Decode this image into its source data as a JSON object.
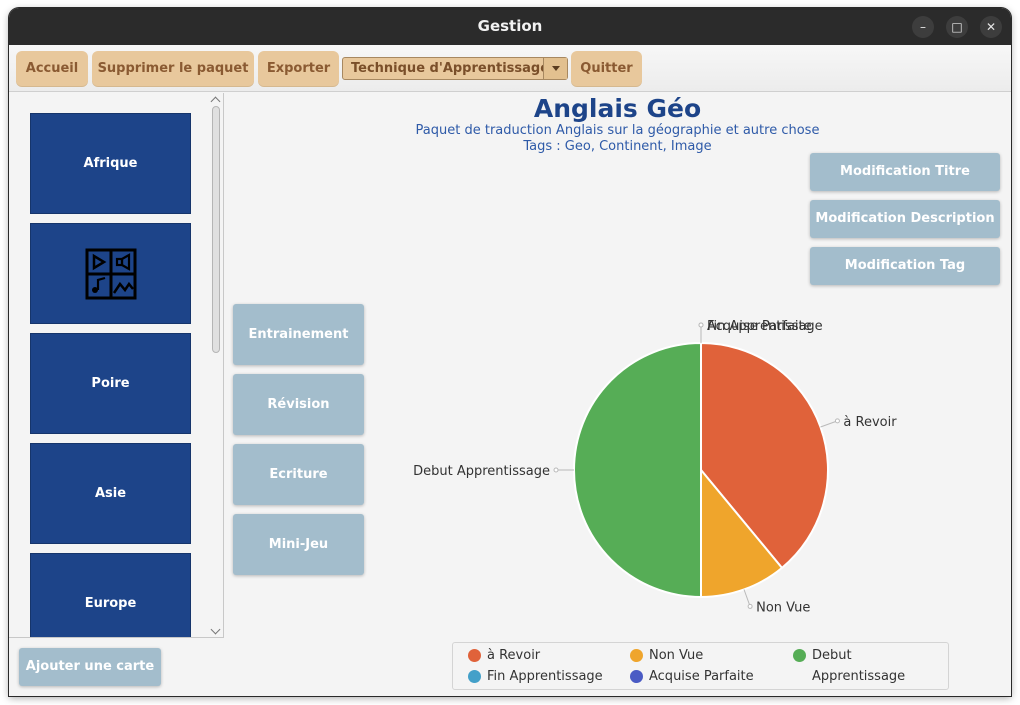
{
  "window": {
    "title": "Gestion",
    "controls": [
      "minimize",
      "maximize",
      "close"
    ]
  },
  "toolbar": {
    "accueil": "Accueil",
    "supprimer": "Supprimer le paquet",
    "exporter": "Exporter",
    "technique": {
      "selected": "Technique d'Apprentissage"
    },
    "quitter": "Quitter"
  },
  "cards": [
    {
      "label": "Afrique",
      "icon": null
    },
    {
      "label": "",
      "icon": "media-grid-icon"
    },
    {
      "label": "Poire",
      "icon": null
    },
    {
      "label": "Asie",
      "icon": null
    },
    {
      "label": "Europe",
      "icon": null
    }
  ],
  "add_card": "Ajouter une carte",
  "deck": {
    "title": "Anglais Géo",
    "description": "Paquet de traduction Anglais sur la géographie et autre chose",
    "tags": "Tags : Geo, Continent, Image"
  },
  "modify_buttons": {
    "title": "Modification Titre",
    "description": "Modification Description",
    "tag": "Modification Tag"
  },
  "study_buttons": {
    "entrainement": "Entrainement",
    "revision": "Révision",
    "ecriture": "Ecriture",
    "minijeu": "Mini-Jeu"
  },
  "colors": {
    "card": "#1d4489",
    "toolbar_button": "#e8c89c",
    "action_button": "#a3bdcc",
    "title": "#1d4489"
  },
  "chart_data": {
    "type": "pie",
    "slices": [
      {
        "label": "à Revoir",
        "value": 39,
        "color": "#e0623a"
      },
      {
        "label": "Non Vue",
        "value": 11,
        "color": "#efa52c"
      },
      {
        "label": "Debut Apprentissage",
        "value": 50,
        "color": "#56ad56"
      },
      {
        "label": "Fin Apprentissage",
        "value": 0,
        "color": "#43a0c9"
      },
      {
        "label": "Acquise Parfaite",
        "value": 0,
        "color": "#4a5bc4"
      }
    ],
    "legend": [
      {
        "label": "à Revoir",
        "color": "#e0623a"
      },
      {
        "label": "Non Vue",
        "color": "#efa52c"
      },
      {
        "label": "Debut Apprentissage",
        "color": "#56ad56"
      },
      {
        "label": "Fin Apprentissage",
        "color": "#43a0c9"
      },
      {
        "label": "Acquise Parfaite",
        "color": "#4a5bc4"
      }
    ],
    "legend_position": "bottom"
  }
}
